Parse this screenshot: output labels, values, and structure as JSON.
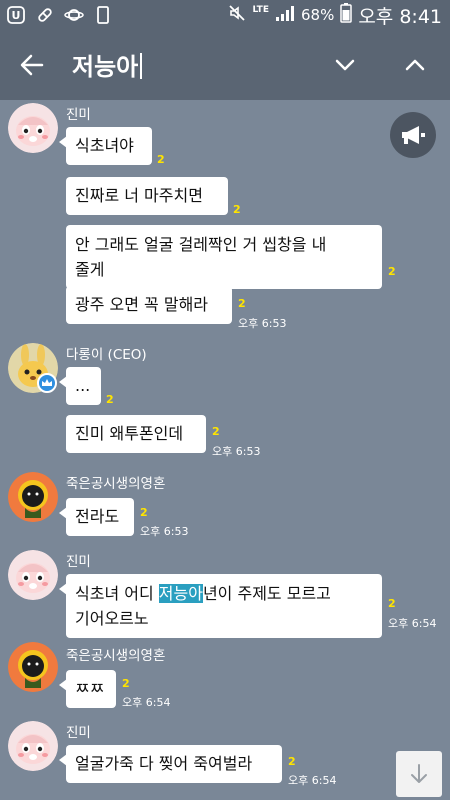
{
  "status_bar": {
    "network": "LTE",
    "battery": "68%",
    "time": "오후 8:41"
  },
  "search": {
    "query": "저능아"
  },
  "messages": [
    {
      "sender": "진미",
      "bubbles": [
        {
          "text": "식초녀야",
          "unread": "2"
        },
        {
          "text": "진짜로 너 마주치면",
          "unread": "2"
        },
        {
          "line1": "안 그래도 얼굴 걸레짝인 거 씹창을 내",
          "line2": "줄게",
          "unread": "2"
        },
        {
          "text": "광주 오면 꼭 말해라",
          "unread": "2",
          "time": "오후 6:53"
        }
      ]
    },
    {
      "sender": "다롱이 (CEO)",
      "bubbles": [
        {
          "text": "...",
          "unread": "2"
        },
        {
          "text": "진미 왜투폰인데",
          "unread": "2",
          "time": "오후 6:53"
        }
      ]
    },
    {
      "sender": "죽은공시생의영혼",
      "bubbles": [
        {
          "text": "전라도",
          "unread": "2",
          "time": "오후 6:53"
        }
      ]
    },
    {
      "sender": "진미",
      "bubbles": [
        {
          "pre": "식초녀 어디 ",
          "highlight": "저능아",
          "post": "년이 주제도 모르고",
          "line2": "기어오르노",
          "unread": "2",
          "time": "오후 6:54"
        }
      ]
    },
    {
      "sender": "죽은공시생의영혼",
      "bubbles": [
        {
          "text": "ㅉㅉ",
          "unread": "2",
          "time": "오후 6:54"
        }
      ]
    },
    {
      "sender": "진미",
      "bubbles": [
        {
          "text": "얼굴가죽 다 찢어 죽여벌라",
          "unread": "2",
          "time": "오후 6:54"
        }
      ]
    }
  ],
  "colors": {
    "chat_bg": "#7a8797",
    "header_bg": "#5a6573",
    "unread": "#ffe400",
    "highlight": "#2a9fc0"
  },
  "icons": {
    "back": "arrow-left-icon",
    "prev": "chevron-down-icon",
    "next": "chevron-up-icon",
    "notice": "megaphone-icon",
    "scroll": "arrow-down-icon"
  }
}
